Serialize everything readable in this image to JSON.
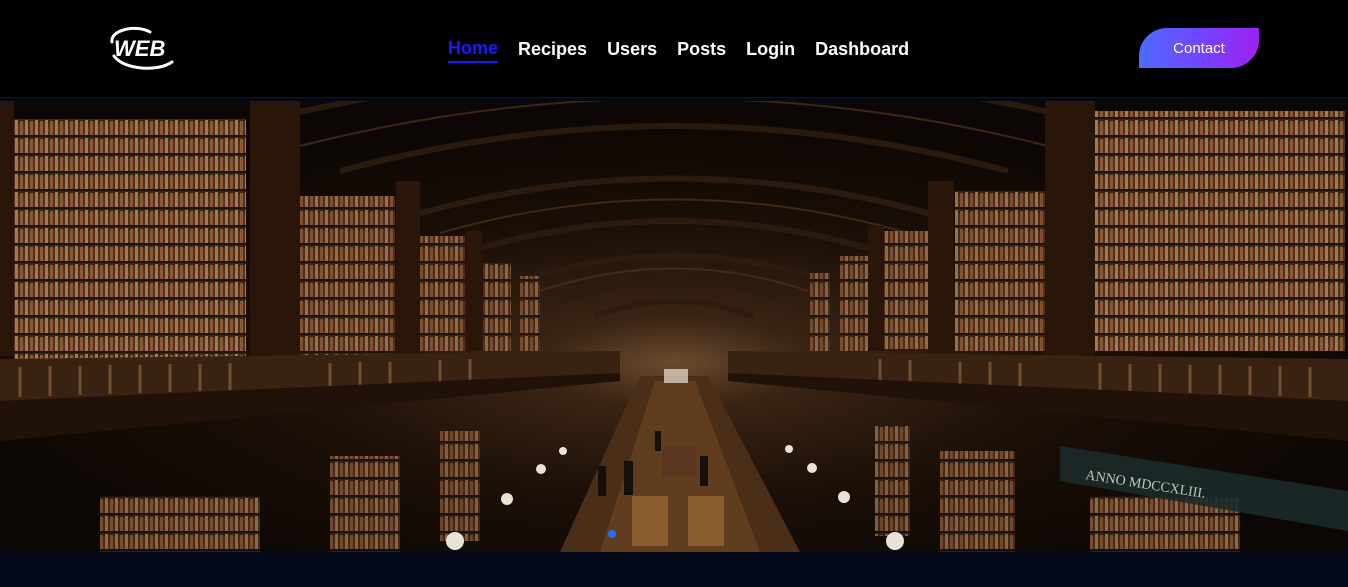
{
  "brand": {
    "logo_text": "WEB"
  },
  "nav": {
    "items": [
      {
        "label": "Home",
        "active": true
      },
      {
        "label": "Recipes",
        "active": false
      },
      {
        "label": "Users",
        "active": false
      },
      {
        "label": "Posts",
        "active": false
      },
      {
        "label": "Login",
        "active": false
      },
      {
        "label": "Dashboard",
        "active": false
      }
    ],
    "active_color": "#1a1aff",
    "text_color": "#ffffff"
  },
  "contact": {
    "label": "Contact",
    "gradient": [
      "#4d6bff",
      "#a020f0"
    ]
  },
  "hero": {
    "image_icon": "library-hall-image",
    "carousel": {
      "slide_count": 1,
      "active_index": 0,
      "indicator_color": "#1f6fff"
    }
  },
  "colors": {
    "navbar_bg": "#000000",
    "page_bg": "#030818"
  }
}
